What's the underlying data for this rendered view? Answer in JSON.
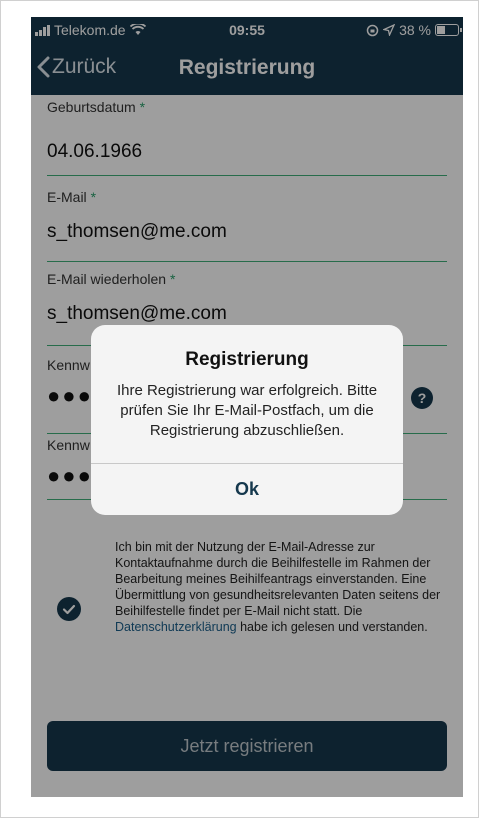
{
  "statusbar": {
    "carrier": "Telekom.de",
    "time": "09:55",
    "battery": "38 %"
  },
  "navbar": {
    "back_label": "Zurück",
    "title": "Registrierung"
  },
  "form": {
    "birthdate": {
      "label": "Geburtsdatum",
      "required": "*",
      "value": "04.06.1966"
    },
    "email": {
      "label": "E-Mail",
      "required": "*",
      "value": "s_thomsen@me.com"
    },
    "email_repeat": {
      "label": "E-Mail wiederholen",
      "required": "*",
      "value": "s_thomsen@me.com"
    },
    "password": {
      "label": "Kennw",
      "value": "●●●"
    },
    "password_repeat": {
      "label": "Kennw",
      "value": "●●●"
    },
    "help": "?"
  },
  "consent": {
    "text": "Ich bin mit der Nutzung der E-Mail-Adresse zur Kontaktaufnahme durch die Beihilfestelle im Rahmen der Bearbeitung meines Beihilfeantrags einverstanden. Eine Übermittlung von gesundheitsrelevanten Daten seitens der Beihilfestelle findet per E-Mail nicht statt. Die ",
    "link": "Datenschutzerklärung",
    "text_after": " habe ich gelesen und verstanden."
  },
  "register_button": "Jetzt registrieren",
  "alert": {
    "title": "Registrierung",
    "message": "Ihre Registrierung war erfolgreich. Bitte prüfen Sie Ihr E-Mail-Postfach, um die Registrierung abzuschließen.",
    "ok": "Ok"
  },
  "colors": {
    "primary": "#15384d",
    "accent": "#3fae7a"
  }
}
